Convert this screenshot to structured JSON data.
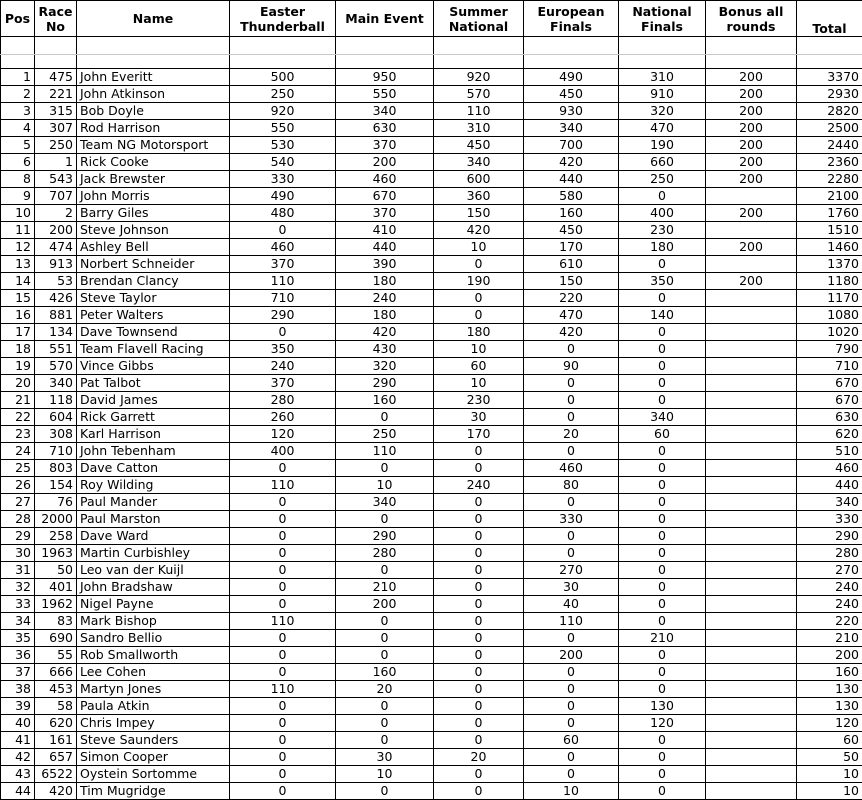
{
  "headers": {
    "pos": "Pos",
    "race_no_1": "Race",
    "race_no_2": "No",
    "name": "Name",
    "easter_1": "Easter",
    "easter_2": "Thunderball",
    "main": "Main Event",
    "summer_1": "Summer",
    "summer_2": "National",
    "euro_1": "European",
    "euro_2": "Finals",
    "natl_1": "National",
    "natl_2": "Finals",
    "bonus_1": "Bonus all",
    "bonus_2": "rounds",
    "total": "Total"
  },
  "rows": [
    [
      "1",
      "475",
      "John Everitt",
      "500",
      "950",
      "920",
      "490",
      "310",
      "200",
      "3370"
    ],
    [
      "2",
      "221",
      "John Atkinson",
      "250",
      "550",
      "570",
      "450",
      "910",
      "200",
      "2930"
    ],
    [
      "3",
      "315",
      "Bob Doyle",
      "920",
      "340",
      "110",
      "930",
      "320",
      "200",
      "2820"
    ],
    [
      "4",
      "307",
      "Rod Harrison",
      "550",
      "630",
      "310",
      "340",
      "470",
      "200",
      "2500"
    ],
    [
      "5",
      "250",
      "Team NG Motorsport",
      "530",
      "370",
      "450",
      "700",
      "190",
      "200",
      "2440"
    ],
    [
      "6",
      "1",
      "Rick Cooke",
      "540",
      "200",
      "340",
      "420",
      "660",
      "200",
      "2360"
    ],
    [
      "8",
      "543",
      "Jack Brewster",
      "330",
      "460",
      "600",
      "440",
      "250",
      "200",
      "2280"
    ],
    [
      "9",
      "707",
      "John Morris",
      "490",
      "670",
      "360",
      "580",
      "0",
      "",
      "2100"
    ],
    [
      "10",
      "2",
      "Barry Giles",
      "480",
      "370",
      "150",
      "160",
      "400",
      "200",
      "1760"
    ],
    [
      "11",
      "200",
      "Steve Johnson",
      "0",
      "410",
      "420",
      "450",
      "230",
      "",
      "1510"
    ],
    [
      "12",
      "474",
      "Ashley Bell",
      "460",
      "440",
      "10",
      "170",
      "180",
      "200",
      "1460"
    ],
    [
      "13",
      "913",
      "Norbert Schneider",
      "370",
      "390",
      "0",
      "610",
      "0",
      "",
      "1370"
    ],
    [
      "14",
      "53",
      "Brendan Clancy",
      "110",
      "180",
      "190",
      "150",
      "350",
      "200",
      "1180"
    ],
    [
      "15",
      "426",
      "Steve Taylor",
      "710",
      "240",
      "0",
      "220",
      "0",
      "",
      "1170"
    ],
    [
      "16",
      "881",
      "Peter Walters",
      "290",
      "180",
      "0",
      "470",
      "140",
      "",
      "1080"
    ],
    [
      "17",
      "134",
      "Dave Townsend",
      "0",
      "420",
      "180",
      "420",
      "0",
      "",
      "1020"
    ],
    [
      "18",
      "551",
      "Team Flavell Racing",
      "350",
      "430",
      "10",
      "0",
      "0",
      "",
      "790"
    ],
    [
      "19",
      "570",
      "Vince Gibbs",
      "240",
      "320",
      "60",
      "90",
      "0",
      "",
      "710"
    ],
    [
      "20",
      "340",
      "Pat Talbot",
      "370",
      "290",
      "10",
      "0",
      "0",
      "",
      "670"
    ],
    [
      "21",
      "118",
      "David James",
      "280",
      "160",
      "230",
      "0",
      "0",
      "",
      "670"
    ],
    [
      "22",
      "604",
      "Rick Garrett",
      "260",
      "0",
      "30",
      "0",
      "340",
      "",
      "630"
    ],
    [
      "23",
      "308",
      "Karl Harrison",
      "120",
      "250",
      "170",
      "20",
      "60",
      "",
      "620"
    ],
    [
      "24",
      "710",
      "John Tebenham",
      "400",
      "110",
      "0",
      "0",
      "0",
      "",
      "510"
    ],
    [
      "25",
      "803",
      "Dave Catton",
      "0",
      "0",
      "0",
      "460",
      "0",
      "",
      "460"
    ],
    [
      "26",
      "154",
      "Roy Wilding",
      "110",
      "10",
      "240",
      "80",
      "0",
      "",
      "440"
    ],
    [
      "27",
      "76",
      "Paul Mander",
      "0",
      "340",
      "0",
      "0",
      "0",
      "",
      "340"
    ],
    [
      "28",
      "2000",
      "Paul Marston",
      "0",
      "0",
      "0",
      "330",
      "0",
      "",
      "330"
    ],
    [
      "29",
      "258",
      "Dave Ward",
      "0",
      "290",
      "0",
      "0",
      "0",
      "",
      "290"
    ],
    [
      "30",
      "1963",
      "Martin Curbishley",
      "0",
      "280",
      "0",
      "0",
      "0",
      "",
      "280"
    ],
    [
      "31",
      "50",
      "Leo van der Kuijl",
      "0",
      "0",
      "0",
      "270",
      "0",
      "",
      "270"
    ],
    [
      "32",
      "401",
      "John Bradshaw",
      "0",
      "210",
      "0",
      "30",
      "0",
      "",
      "240"
    ],
    [
      "33",
      "1962",
      "Nigel Payne",
      "0",
      "200",
      "0",
      "40",
      "0",
      "",
      "240"
    ],
    [
      "34",
      "83",
      "Mark Bishop",
      "110",
      "0",
      "0",
      "110",
      "0",
      "",
      "220"
    ],
    [
      "35",
      "690",
      "Sandro Bellio",
      "0",
      "0",
      "0",
      "0",
      "210",
      "",
      "210"
    ],
    [
      "36",
      "55",
      "Rob Smallworth",
      "0",
      "0",
      "0",
      "200",
      "0",
      "",
      "200"
    ],
    [
      "37",
      "666",
      "Lee Cohen",
      "0",
      "160",
      "0",
      "0",
      "0",
      "",
      "160"
    ],
    [
      "38",
      "453",
      "Martyn Jones",
      "110",
      "20",
      "0",
      "0",
      "0",
      "",
      "130"
    ],
    [
      "39",
      "58",
      "Paula Atkin",
      "0",
      "0",
      "0",
      "0",
      "130",
      "",
      "130"
    ],
    [
      "40",
      "620",
      "Chris Impey",
      "0",
      "0",
      "0",
      "0",
      "120",
      "",
      "120"
    ],
    [
      "41",
      "161",
      "Steve Saunders",
      "0",
      "0",
      "0",
      "60",
      "0",
      "",
      "60"
    ],
    [
      "42",
      "657",
      "Simon Cooper",
      "0",
      "30",
      "20",
      "0",
      "0",
      "",
      "50"
    ],
    [
      "43",
      "6522",
      "Oystein Sortomme",
      "0",
      "10",
      "0",
      "0",
      "0",
      "",
      "10"
    ],
    [
      "44",
      "420",
      "Tim Mugridge",
      "0",
      "0",
      "0",
      "10",
      "0",
      "",
      "10"
    ]
  ]
}
